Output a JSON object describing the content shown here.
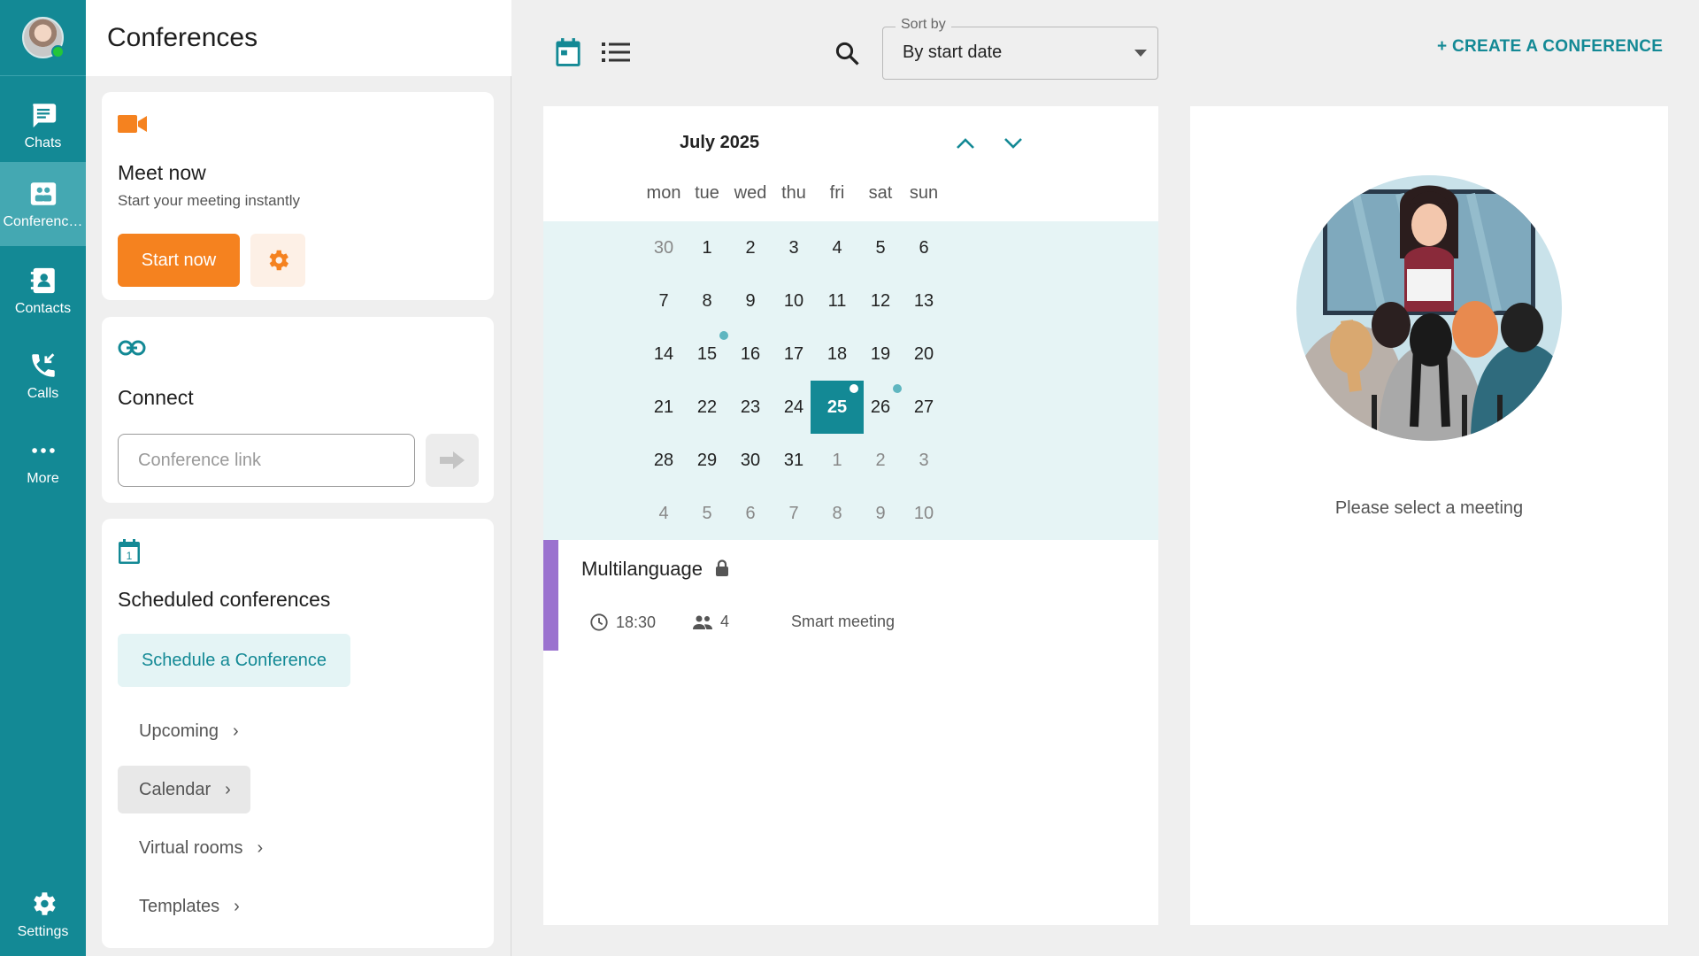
{
  "rail": {
    "items": [
      {
        "label": "Chats",
        "icon": "chat-icon"
      },
      {
        "label": "Conferences",
        "icon": "conference-icon"
      },
      {
        "label": "Contacts",
        "icon": "contacts-icon"
      },
      {
        "label": "Calls",
        "icon": "calls-icon"
      },
      {
        "label": "More",
        "icon": "more-icon"
      }
    ],
    "settings_label": "Settings"
  },
  "panel": {
    "title": "Conferences",
    "meet_now": {
      "title": "Meet now",
      "subtitle": "Start your meeting instantly",
      "start_label": "Start now"
    },
    "connect": {
      "title": "Connect",
      "placeholder": "Conference link"
    },
    "scheduled": {
      "title": "Scheduled conferences",
      "schedule_label": "Schedule a Conference",
      "links": [
        "Upcoming",
        "Calendar",
        "Virtual rooms",
        "Templates"
      ],
      "active_link": "Calendar"
    }
  },
  "toolbar": {
    "sort_label": "Sort by",
    "sort_value": "By start date",
    "create_label": "+ CREATE A CONFERENCE"
  },
  "calendar": {
    "month_title": "July 2025",
    "weekdays": [
      "mon",
      "tue",
      "wed",
      "thu",
      "fri",
      "sat",
      "sun"
    ],
    "weeks": [
      [
        "30",
        "1",
        "2",
        "3",
        "4",
        "5",
        "6"
      ],
      [
        "7",
        "8",
        "9",
        "10",
        "11",
        "12",
        "13"
      ],
      [
        "14",
        "15",
        "16",
        "17",
        "18",
        "19",
        "20"
      ],
      [
        "21",
        "22",
        "23",
        "24",
        "25",
        "26",
        "27"
      ],
      [
        "28",
        "29",
        "30",
        "31",
        "1",
        "2",
        "3"
      ],
      [
        "4",
        "5",
        "6",
        "7",
        "8",
        "9",
        "10"
      ]
    ],
    "selected_day": "25",
    "days_with_events": [
      "15",
      "25",
      "26"
    ],
    "accent_color": "#138995"
  },
  "event": {
    "title": "Multilanguage",
    "time": "18:30",
    "participants": "4",
    "type": "Smart meeting",
    "color": "#9b72cf"
  },
  "detail": {
    "message": "Please select a meeting"
  }
}
